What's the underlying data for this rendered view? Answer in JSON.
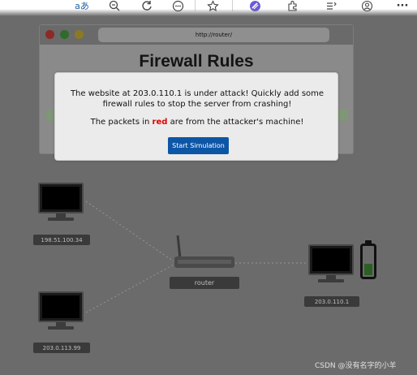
{
  "browser": {
    "toolbar_icons": [
      "read-aloud-icon",
      "zoom-out-icon",
      "refresh-icon",
      "more-icon",
      "favorites-icon",
      "extensions-icon",
      "puzzle-icon",
      "collections-icon",
      "profile-icon",
      "menu-icon"
    ],
    "read_aloud_glyph": "aあ",
    "menu_glyph": "···"
  },
  "sim_window": {
    "url": "http://router/",
    "title": "Firewall Rules"
  },
  "modal": {
    "line1": "The website at 203.0.110.1 is under attack! Quickly add some firewall rules to stop the server from crashing!",
    "line2_prefix": "The packets in ",
    "line2_red": "red",
    "line2_suffix": " are from the attacker's machine!",
    "button_label": "Start Simulation",
    "red_color": "#e00000",
    "button_color": "#0d56a6"
  },
  "network": {
    "attacker_a": {
      "ip": "198.51.100.34"
    },
    "attacker_b": {
      "ip": "203.0.113.99"
    },
    "router": {
      "label": "router"
    },
    "server": {
      "ip": "203.0.110.1"
    },
    "battery_level_pct": 40
  },
  "watermark": "CSDN @没有名字的小羊"
}
